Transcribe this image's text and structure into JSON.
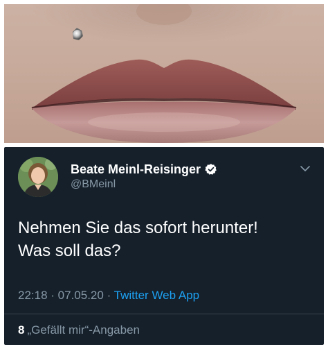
{
  "photo": {
    "subject_icon": "lips-with-piercing-photo"
  },
  "tweet": {
    "author_name": "Beate Meinl-Reisinger",
    "handle": "@BMeinl",
    "verified_icon": "verified-badge-icon",
    "menu_icon": "chevron-down-icon",
    "text_line1": "Nehmen Sie das sofort herunter!",
    "text_line2": "Was soll das?",
    "time": "22:18",
    "separator1": " · ",
    "date": "07.05.20",
    "separator2": " · ",
    "source_app": "Twitter Web App",
    "likes_count": "8",
    "likes_label": "„Gefällt mir“-Angaben"
  },
  "colors": {
    "card_background": "#15202b",
    "secondary_text": "#8899a6",
    "link_blue": "#1da1f2",
    "divider": "#38444d"
  }
}
